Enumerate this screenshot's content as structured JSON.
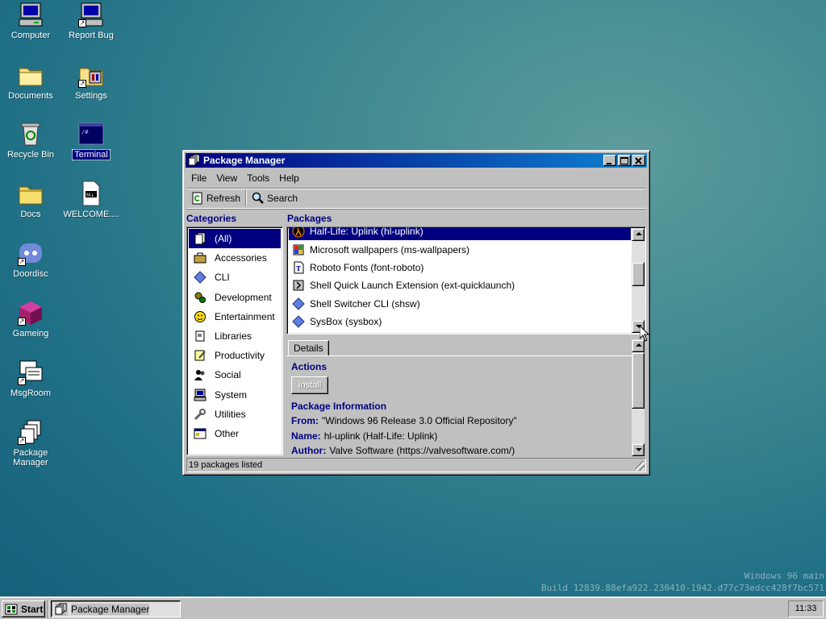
{
  "desktop": {
    "icons": [
      {
        "label": "Computer"
      },
      {
        "label": "Report Bug"
      },
      {
        "label": "Documents"
      },
      {
        "label": "Settings"
      },
      {
        "label": "Recycle Bin"
      },
      {
        "label": "Terminal"
      },
      {
        "label": "Docs"
      },
      {
        "label": "WELCOME...."
      },
      {
        "label": "Doordisc"
      },
      {
        "label": "Gameing"
      },
      {
        "label": "MsgRoom"
      },
      {
        "label": "Package Manager"
      }
    ],
    "watermark": {
      "line1": "Windows 96 main",
      "line2": "Build 12839.88efa922.230410-1942.d77c73edcc428f7bc571"
    }
  },
  "window": {
    "title": "Package Manager",
    "menu": [
      "File",
      "View",
      "Tools",
      "Help"
    ],
    "toolbar": {
      "refresh": "Refresh",
      "search": "Search"
    },
    "categories_heading": "Categories",
    "packages_heading": "Packages",
    "categories": [
      {
        "label": "(All)",
        "icon": "all-icon"
      },
      {
        "label": "Accessories",
        "icon": "briefcase-icon"
      },
      {
        "label": "CLI",
        "icon": "diamond-icon"
      },
      {
        "label": "Development",
        "icon": "gears-icon"
      },
      {
        "label": "Entertainment",
        "icon": "smiley-icon"
      },
      {
        "label": "Libraries",
        "icon": "book-icon"
      },
      {
        "label": "Productivity",
        "icon": "notepad-icon"
      },
      {
        "label": "Social",
        "icon": "people-icon"
      },
      {
        "label": "System",
        "icon": "computer-icon"
      },
      {
        "label": "Utilities",
        "icon": "tools-icon"
      },
      {
        "label": "Other",
        "icon": "window-icon"
      }
    ],
    "packages": [
      {
        "label": "Half-Life: Uplink (hl-uplink)",
        "icon": "halflife-icon"
      },
      {
        "label": "Microsoft wallpapers (ms-wallpapers)",
        "icon": "wallpaper-icon"
      },
      {
        "label": "Roboto Fonts (font-roboto)",
        "icon": "font-icon"
      },
      {
        "label": "Shell Quick Launch Extension (ext-quicklaunch)",
        "icon": "extension-icon"
      },
      {
        "label": "Shell Switcher CLI (shsw)",
        "icon": "diamond-icon"
      },
      {
        "label": "SysBox (sysbox)",
        "icon": "diamond-icon"
      }
    ],
    "details": {
      "tab": "Details",
      "actions_heading": "Actions",
      "install_label": "Install",
      "info_heading": "Package Information",
      "from_key": "From:",
      "from_value": "\"Windows 96 Release 3.0 Official Repository\"",
      "name_key": "Name:",
      "name_value": "hl-uplink (Half-Life: Uplink)",
      "author_key": "Author:",
      "author_value": "Valve Software (https://valvesoftware.com/)"
    },
    "status": "19 packages listed"
  },
  "taskbar": {
    "start_label": "Start",
    "task_label": "Package Manager",
    "clock": "11:33"
  }
}
